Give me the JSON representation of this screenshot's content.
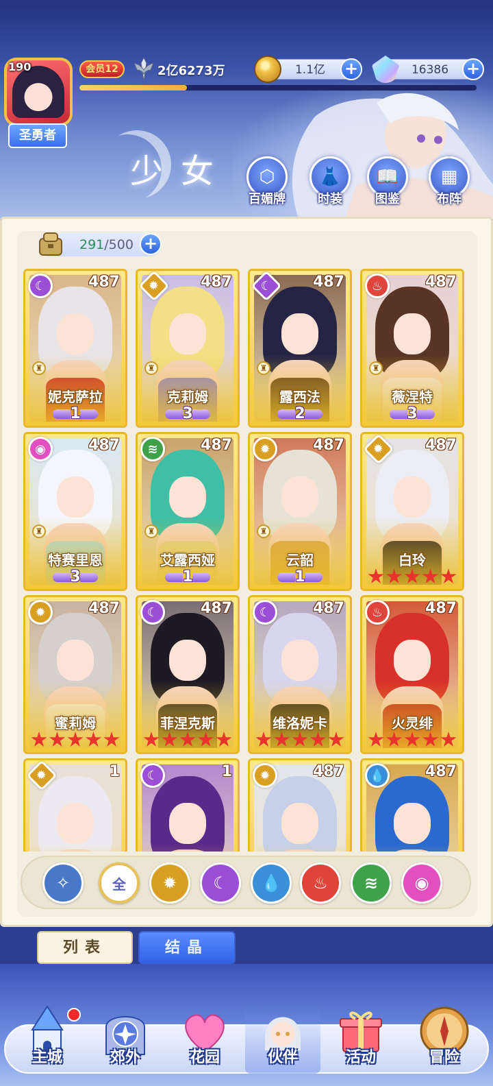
{
  "header": {
    "level": "190",
    "player_title": "圣勇者",
    "vip": "会员12",
    "power": "2亿6273万",
    "exp_progress": 0.27,
    "gold": "1.1亿",
    "gems": "16386",
    "page_title": "少女",
    "buttons": [
      "百媚牌",
      "时装",
      "图鉴",
      "布阵"
    ]
  },
  "capacity": {
    "current": "291",
    "max": "/500"
  },
  "cards": [
    {
      "name": "妮克萨拉",
      "level": "487",
      "element": "moon",
      "rank_type": "wings",
      "rank": "1",
      "hair": "#e8e4e8",
      "outfit": "#c8242c",
      "bg": "#d9b58a"
    },
    {
      "name": "克莉姆",
      "level": "487",
      "element": "sun",
      "rank_type": "wings",
      "rank": "3",
      "hair": "#f3df86",
      "outfit": "#8d7fd6",
      "bg": "#c9bde8"
    },
    {
      "name": "露西法",
      "level": "487",
      "element": "moon",
      "rank_type": "wings",
      "rank": "2",
      "hair": "#252444",
      "outfit": "#5a3a22",
      "bg": "#8a6a54"
    },
    {
      "name": "薇涅特",
      "level": "487",
      "element": "fire",
      "rank_type": "wings",
      "rank": "3",
      "hair": "#5a3424",
      "outfit": "#f2e8ee",
      "bg": "#e6d0d4"
    },
    {
      "name": "特赛里恩",
      "level": "487",
      "element": "heart",
      "rank_type": "wings",
      "rank": "3",
      "hair": "#f4f6fb",
      "outfit": "#a9dcef",
      "bg": "#d8e8f3"
    },
    {
      "name": "艾露西娅",
      "level": "487",
      "element": "wind",
      "rank_type": "wings",
      "rank": "1",
      "hair": "#3fbfa6",
      "outfit": "#e6d49a",
      "bg": "#c9a36c"
    },
    {
      "name": "云韶",
      "level": "487",
      "element": "sun",
      "rank_type": "wings",
      "rank": "1",
      "hair": "#e6e2d6",
      "outfit": "#d8a54c",
      "bg": "#d07a5a"
    },
    {
      "name": "白玲",
      "level": "487",
      "element": "sun",
      "rank_type": "stars",
      "rank": "5",
      "hair": "#eceef4",
      "outfit": "#2a2228",
      "bg": "#e4e2e6"
    },
    {
      "name": "蜜莉姆",
      "level": "487",
      "element": "sun",
      "rank_type": "stars",
      "rank": "5",
      "hair": "#d6d0cc",
      "outfit": "#f2ece6",
      "bg": "#c9b2a0"
    },
    {
      "name": "菲涅克斯",
      "level": "487",
      "element": "moon",
      "rank_type": "stars",
      "rank": "5",
      "hair": "#1e1a24",
      "outfit": "#2c2628",
      "bg": "#7a6e74"
    },
    {
      "name": "维洛妮卡",
      "level": "487",
      "element": "moon",
      "rank_type": "stars",
      "rank": "5",
      "hair": "#d8d6ee",
      "outfit": "#2a2420",
      "bg": "#b4a8c0"
    },
    {
      "name": "火灵绯",
      "level": "487",
      "element": "fire",
      "rank_type": "stars",
      "rank": "5",
      "hair": "#d8302a",
      "outfit": "#c22a24",
      "bg": "#d45a3a"
    },
    {
      "name": "",
      "level": "1",
      "element": "sun",
      "rank_type": "none",
      "rank": "",
      "hair": "#eceaf0",
      "outfit": "#f4efe6",
      "bg": "#e8e0d8"
    },
    {
      "name": "",
      "level": "1",
      "element": "moon",
      "rank_type": "none",
      "rank": "",
      "hair": "#5a2a8a",
      "outfit": "#f0eef6",
      "bg": "#b488d0"
    },
    {
      "name": "",
      "level": "487",
      "element": "sun",
      "rank_type": "none",
      "rank": "",
      "hair": "#c6d0e8",
      "outfit": "#eef0f6",
      "bg": "#e2e6ee"
    },
    {
      "name": "",
      "level": "487",
      "element": "water",
      "rank_type": "none",
      "rank": "",
      "hair": "#2a6ad0",
      "outfit": "#6a4020",
      "bg": "#d8a850"
    }
  ],
  "element_colors": {
    "moon": "#9a4fd6",
    "sun": "#d99f22",
    "fire": "#e0443a",
    "water": "#3a8fd8",
    "wind": "#3fa24a",
    "heart": "#e24fbf",
    "star": "#4a78c8"
  },
  "element_glyphs": {
    "moon": "☾",
    "sun": "✹",
    "fire": "♨",
    "water": "💧",
    "wind": "≋",
    "heart": "◉",
    "star": "✧"
  },
  "filters": [
    {
      "key": "star",
      "label": ""
    },
    {
      "key": "all",
      "label": "全"
    },
    {
      "key": "sun",
      "label": ""
    },
    {
      "key": "moon",
      "label": ""
    },
    {
      "key": "water",
      "label": ""
    },
    {
      "key": "fire",
      "label": ""
    },
    {
      "key": "wind",
      "label": ""
    },
    {
      "key": "heart",
      "label": ""
    }
  ],
  "tabs": {
    "list": "列表",
    "crystal": "结晶"
  },
  "nav": [
    "主城",
    "郊外",
    "花园",
    "伙伴",
    "活动",
    "冒险"
  ]
}
